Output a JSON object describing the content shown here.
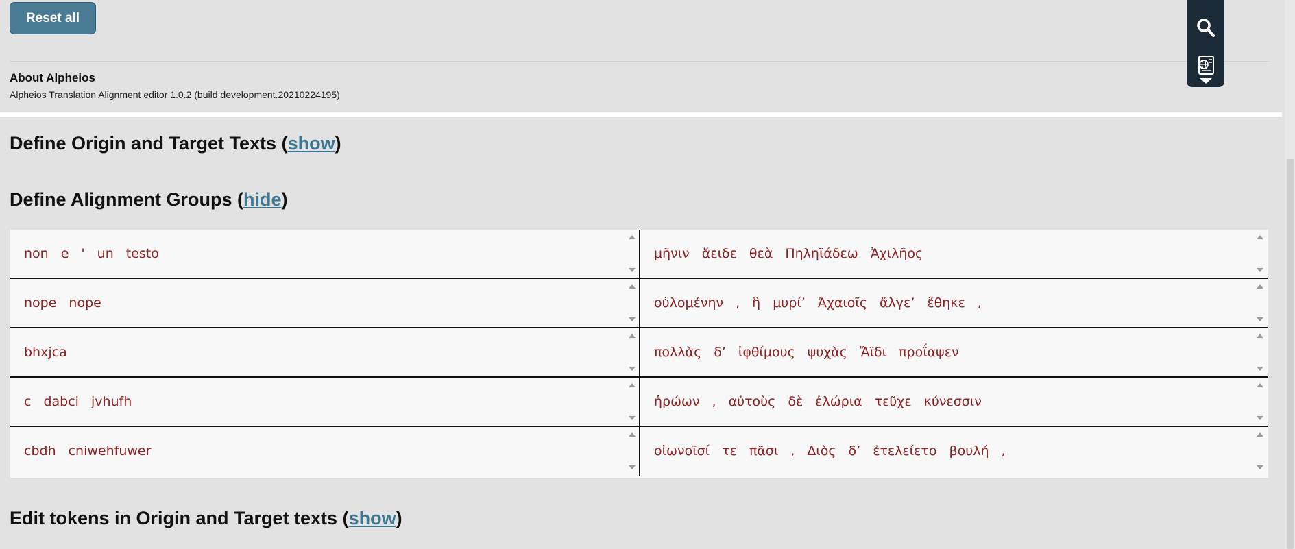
{
  "settings": {
    "reset_label": "Reset all",
    "about_title": "About Alpheios",
    "about_version": "Alpheios Translation Alignment editor 1.0.2 (build development.20210224195)"
  },
  "toolbar": {
    "search_icon": "search-icon",
    "document_icon": "document-globe-icon",
    "collapse_icon": "caret-down-icon"
  },
  "sections": {
    "define_texts": {
      "title": "Define Origin and Target Texts",
      "toggle": "show"
    },
    "alignment_groups": {
      "title": "Define Alignment Groups",
      "toggle": "hide"
    },
    "edit_tokens": {
      "title": "Edit tokens in Origin and Target texts",
      "toggle": "show"
    }
  },
  "alignment": {
    "rows": [
      {
        "origin": [
          "non",
          "e",
          "'",
          "un",
          "testo"
        ],
        "target": [
          "μῆνιν",
          "ἄειδε",
          "θεὰ",
          "Πηληϊάδεω",
          "Ἀχιλῆος"
        ]
      },
      {
        "origin": [
          "nope",
          "nope"
        ],
        "target": [
          "οὐλομένην",
          ",",
          "ἣ",
          "μυρί’",
          "Ἀχαιοῖς",
          "ἄλγε’",
          "ἔθηκε",
          ","
        ]
      },
      {
        "origin": [
          "bhxjca"
        ],
        "target": [
          "πολλὰς",
          "δ’",
          "ἰφθίμους",
          "ψυχὰς",
          "Ἄϊδι",
          "προΐαψεν"
        ]
      },
      {
        "origin": [
          "c",
          "dabci",
          "jvhufh"
        ],
        "target": [
          "ἡρώων",
          ",",
          "αὐτοὺς",
          "δὲ",
          "ἑλώρια",
          "τεῦχε",
          "κύνεσσιν"
        ]
      },
      {
        "origin": [
          "cbdh",
          "cniwehfuwer"
        ],
        "target": [
          "οἰωνοῖσί",
          "τε",
          "πᾶσι",
          ",",
          "Διὸς",
          "δ’",
          "ἐτελείετο",
          "βουλή",
          ","
        ]
      }
    ]
  },
  "colors": {
    "accent": "#4a7b94",
    "link": "#3f7691",
    "token": "#8e2121",
    "toolbar_bg": "#1b2b38",
    "page_bg": "#e2e2e2"
  }
}
